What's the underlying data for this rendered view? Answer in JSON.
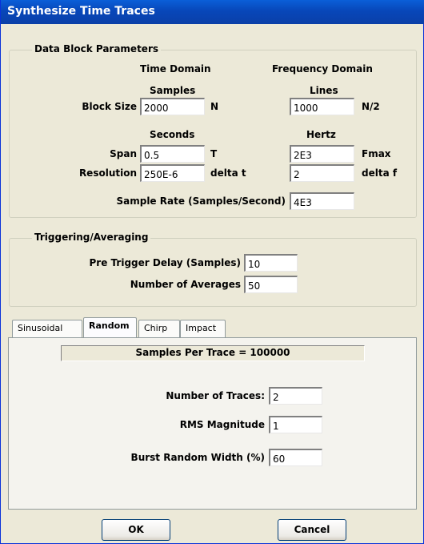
{
  "window": {
    "title": "Synthesize Time Traces"
  },
  "data_block": {
    "legend": "Data Block Parameters",
    "time_domain": "Time Domain",
    "frequency_domain": "Frequency Domain",
    "samples": "Samples",
    "lines": "Lines",
    "block_size_label": "Block Size",
    "block_size_value": "2000",
    "block_size_unit": "N",
    "lines_value": "1000",
    "lines_unit": "N/2",
    "seconds": "Seconds",
    "hertz": "Hertz",
    "span_label": "Span",
    "span_value": "0.5",
    "span_unit": "T",
    "fmax_value": "2E3",
    "fmax_unit": "Fmax",
    "resolution_label": "Resolution",
    "resolution_value": "250E-6",
    "resolution_unit": "delta t",
    "delta_f_value": "2",
    "delta_f_unit": "delta f",
    "sample_rate_label": "Sample Rate (Samples/Second)",
    "sample_rate_value": "4E3"
  },
  "triggering": {
    "legend": "Triggering/Averaging",
    "pre_trigger_label": "Pre Trigger Delay (Samples)",
    "pre_trigger_value": "10",
    "averages_label": "Number of Averages",
    "averages_value": "50"
  },
  "tabs": [
    {
      "label": "Sinusoidal"
    },
    {
      "label": "Random"
    },
    {
      "label": "Chirp"
    },
    {
      "label": "Impact"
    }
  ],
  "random": {
    "samples_per_trace": "Samples Per Trace = 100000",
    "traces_label": "Number of Traces:",
    "traces_value": "2",
    "rms_label": "RMS Magnitude",
    "rms_value": "1",
    "burst_label": "Burst Random Width (%)",
    "burst_value": "60"
  },
  "buttons": {
    "ok": "OK",
    "cancel": "Cancel"
  }
}
